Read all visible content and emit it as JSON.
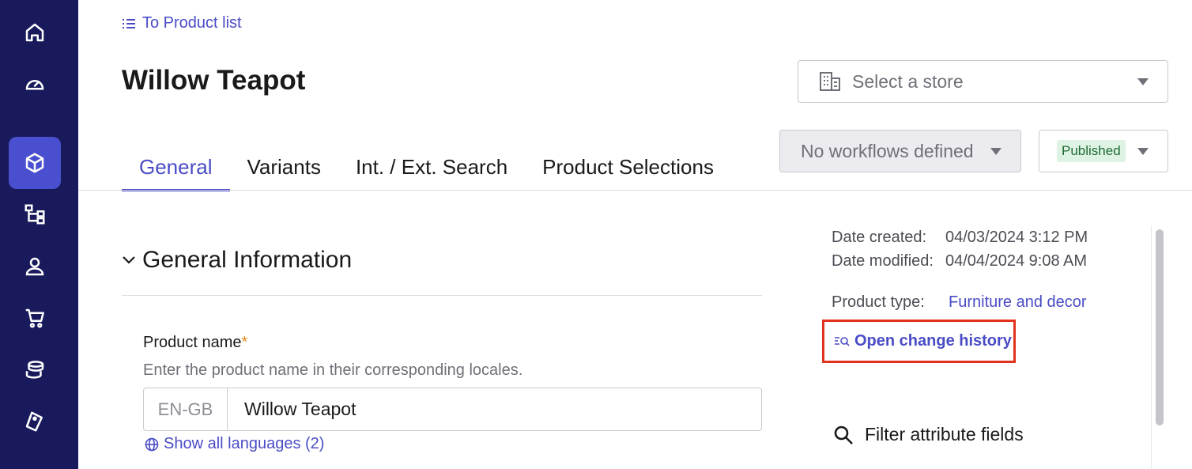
{
  "sidebar": {
    "items": [
      {
        "icon": "home-icon",
        "active": false
      },
      {
        "icon": "dashboard-icon",
        "active": false
      },
      {
        "icon": "product-box-icon",
        "active": true
      },
      {
        "icon": "hierarchy-icon",
        "active": false
      },
      {
        "icon": "user-icon",
        "active": false
      },
      {
        "icon": "cart-icon",
        "active": false
      },
      {
        "icon": "coins-icon",
        "active": false
      },
      {
        "icon": "tags-icon",
        "active": false
      }
    ]
  },
  "header": {
    "back_link": "To Product list",
    "title": "Willow Teapot",
    "store_placeholder": "Select a store",
    "workflow": "No workflows defined",
    "status": "Published"
  },
  "tabs": [
    {
      "label": "General",
      "active": true
    },
    {
      "label": "Variants",
      "active": false
    },
    {
      "label": "Int. / Ext. Search",
      "active": false
    },
    {
      "label": "Product Selections",
      "active": false
    }
  ],
  "general": {
    "section_title": "General Information",
    "product_name_label": "Product name",
    "required_mark": "*",
    "product_name_help": "Enter the product name in their corresponding locales.",
    "locale": "EN-GB",
    "product_name_value": "Willow Teapot",
    "show_languages": "Show all languages (2)"
  },
  "meta": {
    "date_created_label": "Date created:",
    "date_created": "04/03/2024 3:12 PM",
    "date_modified_label": "Date modified:",
    "date_modified": "04/04/2024 9:08 AM",
    "product_type_label": "Product type:",
    "product_type": "Furniture and decor",
    "change_history": "Open change history",
    "filter_fields": "Filter attribute fields"
  },
  "colors": {
    "sidebar_bg": "#181a5c",
    "accent": "#4a4cc6",
    "highlight_box": "#e0321c",
    "published_badge": "#dff3e4"
  }
}
